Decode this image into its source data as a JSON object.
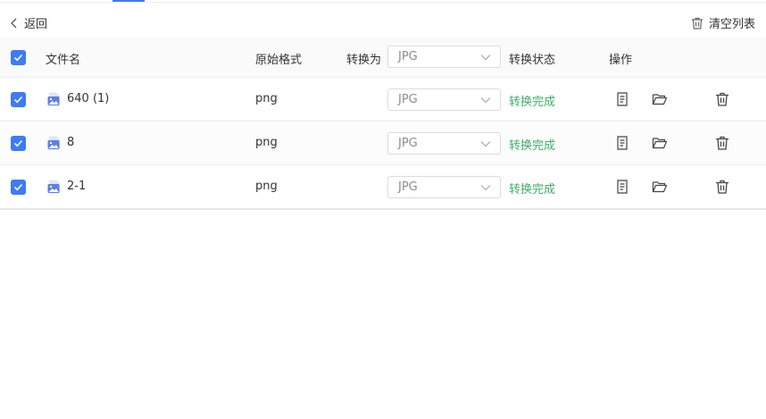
{
  "toolbar": {
    "back_label": "返回",
    "clear_label": "清空列表"
  },
  "table": {
    "headers": {
      "filename": "文件名",
      "original_format": "原始格式",
      "convert_to": "转换为",
      "convert_to_value": "JPG",
      "status": "转换状态",
      "actions": "操作"
    },
    "rows": [
      {
        "name": "640 (1)",
        "format": "png",
        "target": "JPG",
        "status": "转换完成",
        "checked": true
      },
      {
        "name": "8",
        "format": "png",
        "target": "JPG",
        "status": "转换完成",
        "checked": true
      },
      {
        "name": "2-1",
        "format": "png",
        "target": "JPG",
        "status": "转换完成",
        "checked": true
      }
    ]
  },
  "colors": {
    "accent": "#3d7bf7",
    "success": "#3fae67",
    "file_icon": "#5b7ee8"
  },
  "icons": [
    "chevron-left-icon",
    "trash-icon",
    "check-icon",
    "image-file-icon",
    "chevron-down-icon",
    "document-icon",
    "folder-icon"
  ]
}
